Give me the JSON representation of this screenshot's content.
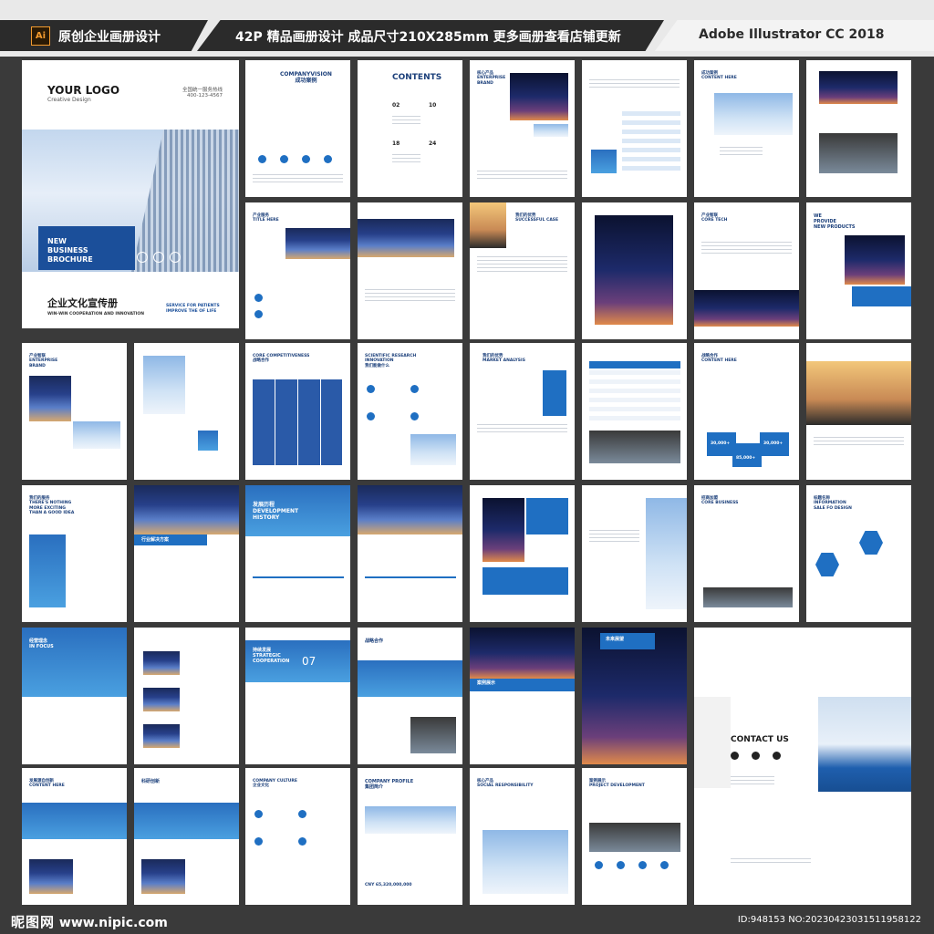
{
  "header": {
    "ai_badge": "Ai",
    "left_title": "原创企业画册设计",
    "middle_title": "42P 精品画册设计 成品尺寸210X285mm 更多画册查看店铺更新",
    "right_title": "Adobe Illustrator CC 2018"
  },
  "cover": {
    "logo": "YOUR LOGO",
    "logo_sub": "Creative Design",
    "phone_label": "全国统一服务热线",
    "phone": "400-123-4567",
    "brochure_title": "NEW\nBUSINESS\nBROCHURE",
    "title_cn": "企业文化宣传册",
    "tagline": "WIN-WIN COOPERATION AND INNOVATION",
    "service": "SERVICE FOR PATIENTS\nIMPROVE THE OF LIFE"
  },
  "pages": [
    {
      "title": "COMPANYVISION\n成功案例"
    },
    {
      "title": "CONTENTS"
    },
    {
      "title": "核心产品\nENTERPRISE\nBRAND"
    },
    {
      "title": ""
    },
    {
      "title": "成功案例\nCONTENT HERE"
    },
    {
      "title": ""
    },
    {
      "title": "产业服务\nTITLE HERE"
    },
    {
      "title": ""
    },
    {
      "title": "我们的优势\nSUCCESSFUL CASE"
    },
    {
      "title": ""
    },
    {
      "title": "产业智联\nCORE TECH"
    },
    {
      "title": "WE\nPROVIDE\nNEW PRODUCTS"
    },
    {
      "title": "产业智联\nENTERPRISE\nBRAND"
    },
    {
      "title": ""
    },
    {
      "title": "CORE COMPETITIVENESS\n战略合作"
    },
    {
      "title": "SCIENTIFIC RESEARCH\nINNOVATION\n我们能做什么"
    },
    {
      "title": "我们的优势\nMARKET ANALYSIS"
    },
    {
      "title": ""
    },
    {
      "title": "战略合作\nCONTENT HERE"
    },
    {
      "title": ""
    },
    {
      "title": "我们的服务\nTHERE'S NOTHING\nMORE EXCITING\nTHAN A GOOD IDEA"
    },
    {
      "title": "行业解决方案"
    },
    {
      "title": "发展历程\nDEVELOPMENT\nHISTORY"
    },
    {
      "title": ""
    },
    {
      "title": ""
    },
    {
      "title": ""
    },
    {
      "title": "招商加盟\nCORE BUSINESS"
    },
    {
      "title": "标题名称\nINFORMATION\nSALE FO DESIGN"
    },
    {
      "title": "经营理念\nIN FOCUS"
    },
    {
      "title": ""
    },
    {
      "title": "持续发展\nSTRATEGIC\nCOOPERATION"
    },
    {
      "title": "战略合作"
    },
    {
      "title": "案例展示"
    },
    {
      "title": "未来展望"
    },
    {
      "title": "发展源自创新\nCONTENT HERE"
    },
    {
      "title": "科研创新"
    },
    {
      "title": "COMPANY CULTURE\n企业文化"
    },
    {
      "title": "COMPANY PROFILE\n集团简介"
    },
    {
      "title": "核心产品\nSOCIAL RESPONSIBILITY"
    },
    {
      "title": "案例展示\nPROJECT DEVELOPMENT"
    }
  ],
  "contact": {
    "title": "CONTACT US"
  },
  "contents_numbers": [
    "02",
    "10",
    "18",
    "24"
  ],
  "stats": [
    "30,000+",
    "85,000+",
    "30,000+"
  ],
  "profile_value": "CNY 65,320,000,000",
  "history_badge": "07",
  "footer": {
    "watermark_cn": "昵图网",
    "watermark_url": "www.nipic.com",
    "id_text": "ID:948153 NO:20230423031511958122"
  }
}
